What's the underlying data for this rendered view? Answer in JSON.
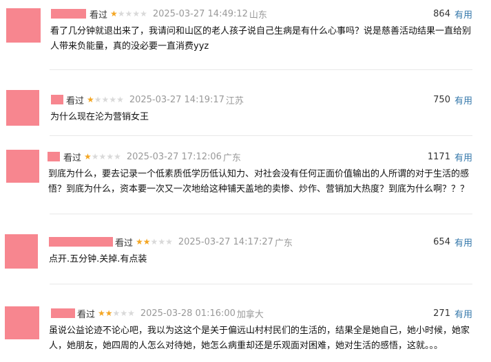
{
  "reviews": [
    {
      "watched": "看过",
      "rating": 1,
      "time": "2025-03-27 14:49:12",
      "location": "山东",
      "votes": "864",
      "useful_label": "有用",
      "content": [
        "看了几分钟就退出来了，我请问和山区的老人孩子说自己生病是有什么心事吗？说是慈善活动结果一直给别",
        "人带来负能量，真的没必要一直消费yyz"
      ]
    },
    {
      "watched": "看过",
      "rating": 1,
      "time": "2025-03-27 14:19:17",
      "location": "江苏",
      "votes": "750",
      "useful_label": "有用",
      "content": [
        "为什么现在沦为营销女王"
      ]
    },
    {
      "watched": "看过",
      "rating": 1,
      "time": "2025-03-27 17:12:06",
      "location": "广东",
      "votes": "1171",
      "useful_label": "有用",
      "content": [
        "到底为什么，要去记录一个低素质低学历低认知力、对社会没有任何正面价值输出的人所谓的对于生活的感",
        "悟？到底为什么，资本要一次又一次地给这种铺天盖地的卖惨、炒作、营销加大热度？到底为什么啊？？？"
      ]
    },
    {
      "watched": "看过",
      "rating": 2,
      "time": "2025-03-27 14:17:27",
      "location": "广东",
      "votes": "654",
      "useful_label": "有用",
      "content": [
        "点开.五分钟.关掉.有点装"
      ]
    },
    {
      "watched": "看过",
      "rating": 2,
      "time": "2025-03-28 01:16:00",
      "location": "加拿大",
      "votes": "271",
      "useful_label": "有用",
      "content": [
        "虽说公益论迹不论心吧，我以为这这个是关于偏远山村村民们的生活的，结果全是她自己，她小时候，她家",
        "人，她朋友，她四周的人怎么对待她，她怎么病重却还是乐观面对困难，她对生活的感悟，这就。。。"
      ]
    }
  ],
  "colors": {
    "avatar": "#f7868f",
    "star_on": "#f4a623",
    "star_off": "#d9d9d9",
    "useful": "#3377aa",
    "meta": "#999999"
  }
}
